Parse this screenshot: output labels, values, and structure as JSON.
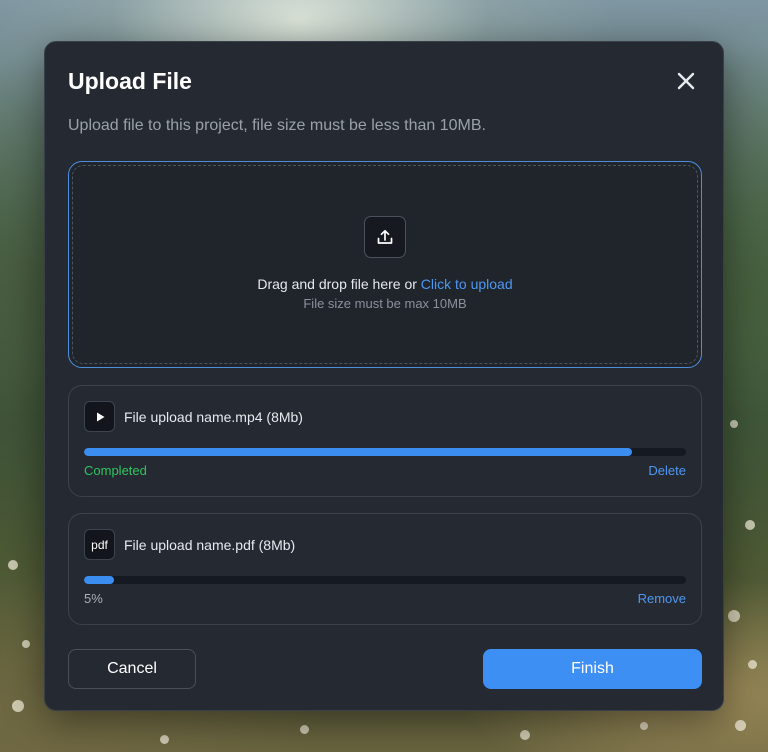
{
  "dialog": {
    "title": "Upload File",
    "subtitle": "Upload file to this project, file size must be less than 10MB.",
    "close_icon": "close-icon"
  },
  "dropzone": {
    "icon": "upload-icon",
    "text": "Drag and drop file here or ",
    "link": "Click to upload",
    "hint": "File size must be max 10MB"
  },
  "files": [
    {
      "icon": "play-icon",
      "name": "File upload name.mp4 (8Mb)",
      "progress_percent": 91,
      "status": "Completed",
      "action": "Delete"
    },
    {
      "icon": "pdf-file-icon",
      "icon_text": "pdf",
      "name": "File upload name.pdf (8Mb)",
      "progress_percent": 5,
      "status": "5%",
      "action": "Remove"
    }
  ],
  "footer": {
    "cancel_label": "Cancel",
    "finish_label": "Finish"
  },
  "colors": {
    "accent": "#3d8ff3",
    "link": "#4e97f0",
    "success": "#2ec45f",
    "modal_bg": "#252a32",
    "status_neutral": "#aab0b8"
  }
}
